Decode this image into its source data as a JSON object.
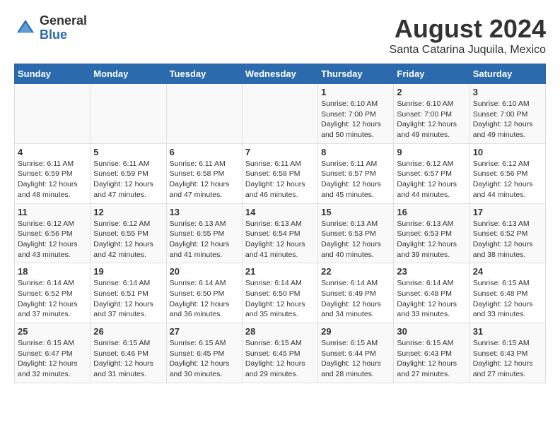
{
  "header": {
    "logo_general": "General",
    "logo_blue": "Blue",
    "title": "August 2024",
    "subtitle": "Santa Catarina Juquila, Mexico"
  },
  "days_of_week": [
    "Sunday",
    "Monday",
    "Tuesday",
    "Wednesday",
    "Thursday",
    "Friday",
    "Saturday"
  ],
  "weeks": [
    [
      {
        "day": "",
        "info": ""
      },
      {
        "day": "",
        "info": ""
      },
      {
        "day": "",
        "info": ""
      },
      {
        "day": "",
        "info": ""
      },
      {
        "day": "1",
        "info": "Sunrise: 6:10 AM\nSunset: 7:00 PM\nDaylight: 12 hours\nand 50 minutes."
      },
      {
        "day": "2",
        "info": "Sunrise: 6:10 AM\nSunset: 7:00 PM\nDaylight: 12 hours\nand 49 minutes."
      },
      {
        "day": "3",
        "info": "Sunrise: 6:10 AM\nSunset: 7:00 PM\nDaylight: 12 hours\nand 49 minutes."
      }
    ],
    [
      {
        "day": "4",
        "info": "Sunrise: 6:11 AM\nSunset: 6:59 PM\nDaylight: 12 hours\nand 48 minutes."
      },
      {
        "day": "5",
        "info": "Sunrise: 6:11 AM\nSunset: 6:59 PM\nDaylight: 12 hours\nand 47 minutes."
      },
      {
        "day": "6",
        "info": "Sunrise: 6:11 AM\nSunset: 6:58 PM\nDaylight: 12 hours\nand 47 minutes."
      },
      {
        "day": "7",
        "info": "Sunrise: 6:11 AM\nSunset: 6:58 PM\nDaylight: 12 hours\nand 46 minutes."
      },
      {
        "day": "8",
        "info": "Sunrise: 6:11 AM\nSunset: 6:57 PM\nDaylight: 12 hours\nand 45 minutes."
      },
      {
        "day": "9",
        "info": "Sunrise: 6:12 AM\nSunset: 6:57 PM\nDaylight: 12 hours\nand 44 minutes."
      },
      {
        "day": "10",
        "info": "Sunrise: 6:12 AM\nSunset: 6:56 PM\nDaylight: 12 hours\nand 44 minutes."
      }
    ],
    [
      {
        "day": "11",
        "info": "Sunrise: 6:12 AM\nSunset: 6:56 PM\nDaylight: 12 hours\nand 43 minutes."
      },
      {
        "day": "12",
        "info": "Sunrise: 6:12 AM\nSunset: 6:55 PM\nDaylight: 12 hours\nand 42 minutes."
      },
      {
        "day": "13",
        "info": "Sunrise: 6:13 AM\nSunset: 6:55 PM\nDaylight: 12 hours\nand 41 minutes."
      },
      {
        "day": "14",
        "info": "Sunrise: 6:13 AM\nSunset: 6:54 PM\nDaylight: 12 hours\nand 41 minutes."
      },
      {
        "day": "15",
        "info": "Sunrise: 6:13 AM\nSunset: 6:53 PM\nDaylight: 12 hours\nand 40 minutes."
      },
      {
        "day": "16",
        "info": "Sunrise: 6:13 AM\nSunset: 6:53 PM\nDaylight: 12 hours\nand 39 minutes."
      },
      {
        "day": "17",
        "info": "Sunrise: 6:13 AM\nSunset: 6:52 PM\nDaylight: 12 hours\nand 38 minutes."
      }
    ],
    [
      {
        "day": "18",
        "info": "Sunrise: 6:14 AM\nSunset: 6:52 PM\nDaylight: 12 hours\nand 37 minutes."
      },
      {
        "day": "19",
        "info": "Sunrise: 6:14 AM\nSunset: 6:51 PM\nDaylight: 12 hours\nand 37 minutes."
      },
      {
        "day": "20",
        "info": "Sunrise: 6:14 AM\nSunset: 6:50 PM\nDaylight: 12 hours\nand 36 minutes."
      },
      {
        "day": "21",
        "info": "Sunrise: 6:14 AM\nSunset: 6:50 PM\nDaylight: 12 hours\nand 35 minutes."
      },
      {
        "day": "22",
        "info": "Sunrise: 6:14 AM\nSunset: 6:49 PM\nDaylight: 12 hours\nand 34 minutes."
      },
      {
        "day": "23",
        "info": "Sunrise: 6:14 AM\nSunset: 6:48 PM\nDaylight: 12 hours\nand 33 minutes."
      },
      {
        "day": "24",
        "info": "Sunrise: 6:15 AM\nSunset: 6:48 PM\nDaylight: 12 hours\nand 33 minutes."
      }
    ],
    [
      {
        "day": "25",
        "info": "Sunrise: 6:15 AM\nSunset: 6:47 PM\nDaylight: 12 hours\nand 32 minutes."
      },
      {
        "day": "26",
        "info": "Sunrise: 6:15 AM\nSunset: 6:46 PM\nDaylight: 12 hours\nand 31 minutes."
      },
      {
        "day": "27",
        "info": "Sunrise: 6:15 AM\nSunset: 6:45 PM\nDaylight: 12 hours\nand 30 minutes."
      },
      {
        "day": "28",
        "info": "Sunrise: 6:15 AM\nSunset: 6:45 PM\nDaylight: 12 hours\nand 29 minutes."
      },
      {
        "day": "29",
        "info": "Sunrise: 6:15 AM\nSunset: 6:44 PM\nDaylight: 12 hours\nand 28 minutes."
      },
      {
        "day": "30",
        "info": "Sunrise: 6:15 AM\nSunset: 6:43 PM\nDaylight: 12 hours\nand 27 minutes."
      },
      {
        "day": "31",
        "info": "Sunrise: 6:15 AM\nSunset: 6:43 PM\nDaylight: 12 hours\nand 27 minutes."
      }
    ]
  ]
}
